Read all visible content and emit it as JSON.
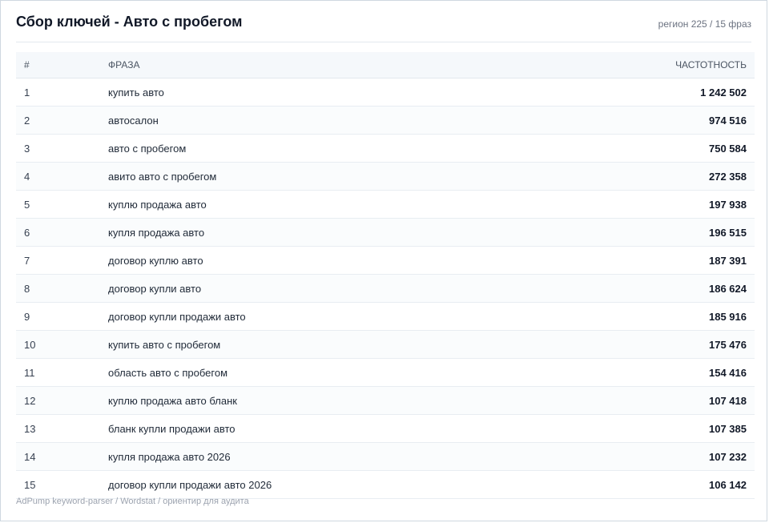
{
  "header": {
    "title": "Сбор ключей - Авто с пробегом",
    "meta": "регион 225 / 15 фраз"
  },
  "table": {
    "columns": {
      "num": "#",
      "phrase": "ФРАЗА",
      "freq": "ЧАСТОТНОСТЬ"
    },
    "rows": [
      {
        "num": "1",
        "phrase": "купить авто",
        "freq": "1 242 502"
      },
      {
        "num": "2",
        "phrase": "автосалон",
        "freq": "974 516"
      },
      {
        "num": "3",
        "phrase": "авто с пробегом",
        "freq": "750 584"
      },
      {
        "num": "4",
        "phrase": "авито авто с пробегом",
        "freq": "272 358"
      },
      {
        "num": "5",
        "phrase": "куплю продажа авто",
        "freq": "197 938"
      },
      {
        "num": "6",
        "phrase": "купля продажа авто",
        "freq": "196 515"
      },
      {
        "num": "7",
        "phrase": "договор куплю авто",
        "freq": "187 391"
      },
      {
        "num": "8",
        "phrase": "договор купли авто",
        "freq": "186 624"
      },
      {
        "num": "9",
        "phrase": "договор купли продажи авто",
        "freq": "185 916"
      },
      {
        "num": "10",
        "phrase": "купить авто с пробегом",
        "freq": "175 476"
      },
      {
        "num": "11",
        "phrase": "область авто с пробегом",
        "freq": "154 416"
      },
      {
        "num": "12",
        "phrase": "куплю продажа авто бланк",
        "freq": "107 418"
      },
      {
        "num": "13",
        "phrase": "бланк купли продажи авто",
        "freq": "107 385"
      },
      {
        "num": "14",
        "phrase": "купля продажа авто 2026",
        "freq": "107 232"
      },
      {
        "num": "15",
        "phrase": "договор купли продажи авто 2026",
        "freq": "106 142"
      }
    ]
  },
  "footer": {
    "text": "AdPump keyword-parser / Wordstat / ориентир для аудита"
  }
}
